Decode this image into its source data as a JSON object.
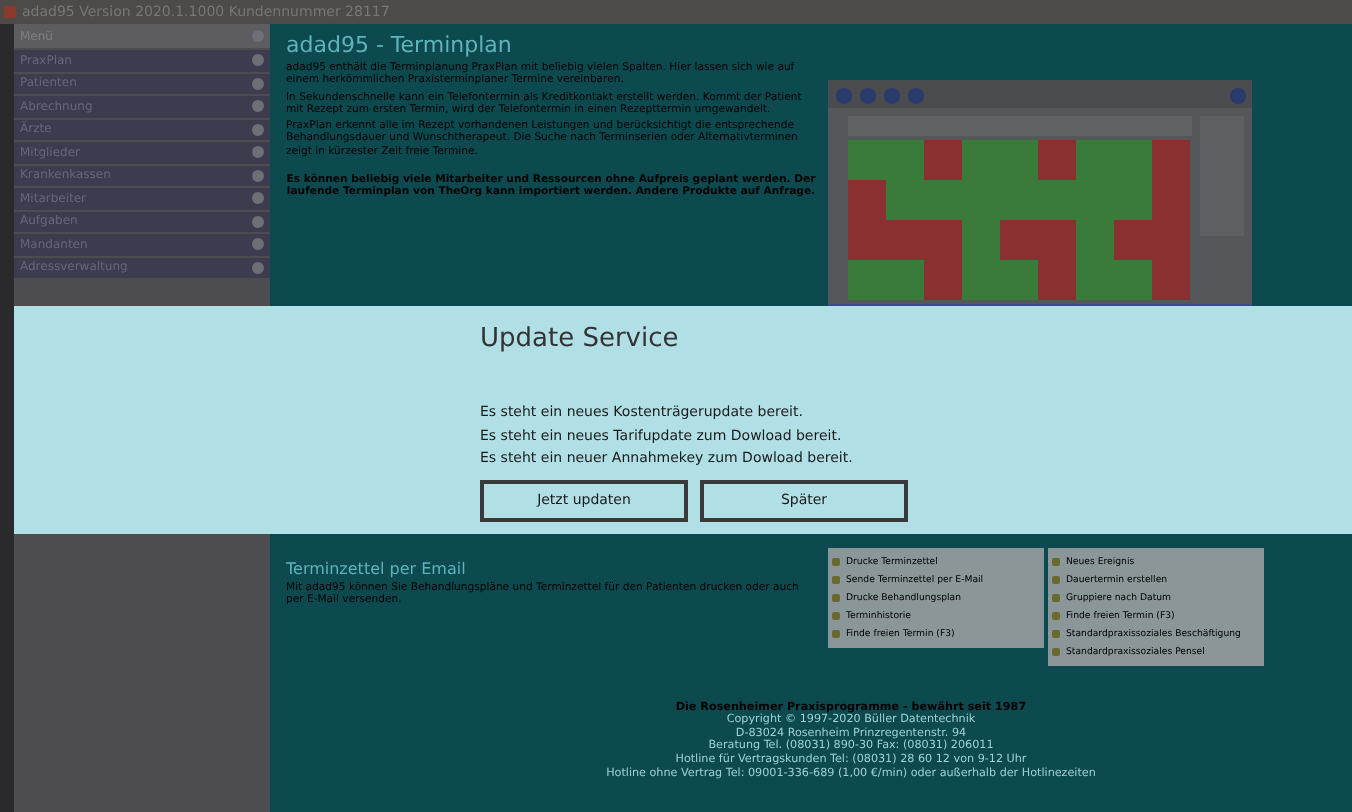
{
  "window": {
    "title": "adad95 Version 2020.1.1000 Kundennummer 28117"
  },
  "sidebar": {
    "header": "Menü",
    "items": [
      {
        "label": "PraxPlan"
      },
      {
        "label": "Patienten"
      },
      {
        "label": "Abrechnung"
      },
      {
        "label": "Ärzte"
      },
      {
        "label": "Mitglieder"
      },
      {
        "label": "Krankenkassen"
      },
      {
        "label": "Mitarbeiter"
      },
      {
        "label": "Aufgaben"
      },
      {
        "label": "Mandanten"
      },
      {
        "label": "Adressverwaltung"
      }
    ]
  },
  "content": {
    "heading": "adad95 - Terminplan",
    "paragraphs": [
      "adad95 enthält die Terminplanung PraxPlan mit beliebig vielen Spalten. Hier lassen sich wie auf einem herkömmlichen Praxisterminplaner Termine vereinbaren.",
      "In Sekundenschnelle kann ein Telefontermin als Kreditkontakt erstellt werden. Kommt der Patient mit Rezept zum ersten Termin, wird der Telefontermin in einen Rezepttermin umgewandelt.",
      "PraxPlan erkennt alle im Rezept vorhandenen Leistungen und berücksichtigt die entsprechende Behandlungsdauer und Wunschtherapeut. Die Suche nach Terminserien oder Alternativterminen zeigt in kürzester Zeit freie Termine."
    ],
    "notice": "Es können beliebig viele Mitarbeiter und Ressourcen ohne Aufpreis geplant werden. Der laufende Terminplan von TheOrg kann importiert werden. Andere Produkte auf Anfrage.",
    "section_heading": "Terminzettel per Email",
    "section_text": "Mit adad95 können Sie Behandlungspläne und Terminzettel für den Patienten drucken oder auch per E-Mail versenden.",
    "menus": [
      {
        "items": [
          "Drucke Terminzettel",
          "Sende Terminzettel per E-Mail",
          "Drucke Behandlungsplan",
          "Terminhistorie",
          "Finde freien Termin (F3)"
        ]
      },
      {
        "items": [
          "Neues Ereignis",
          "Dauertermin erstellen",
          "Gruppiere nach Datum",
          "Finde freien Termin (F3)",
          "Standardpraxissoziales Beschäftigung",
          "Standardpraxissoziales Pensel"
        ]
      }
    ],
    "footer": {
      "title": "Die Rosenheimer Praxisprogramme - bewährt seit 1987",
      "lines": [
        "Copyright © 1997-2020 Büller Datentechnik",
        "D-83024 Rosenheim Prinzregentenstr. 94",
        "Beratung Tel. (08031) 890-30 Fax: (08031) 206011",
        "Hotline für Vertragskunden Tel: (08031) 28 60 12 von 9-12 Uhr",
        "Hotline ohne Vertrag Tel: 09001-336-689 (1,00 €/min) oder außerhalb der Hotlinezeiten"
      ]
    }
  },
  "dialog": {
    "title": "Update Service",
    "messages": [
      "Es steht ein neues Kostenträgerupdate bereit.",
      "Es steht ein neues Tarifupdate zum Dowload bereit.",
      "Es steht ein neuer Annahmekey zum Dowload bereit."
    ],
    "buttons": [
      {
        "label": "Jetzt updaten"
      },
      {
        "label": "Später"
      }
    ]
  }
}
